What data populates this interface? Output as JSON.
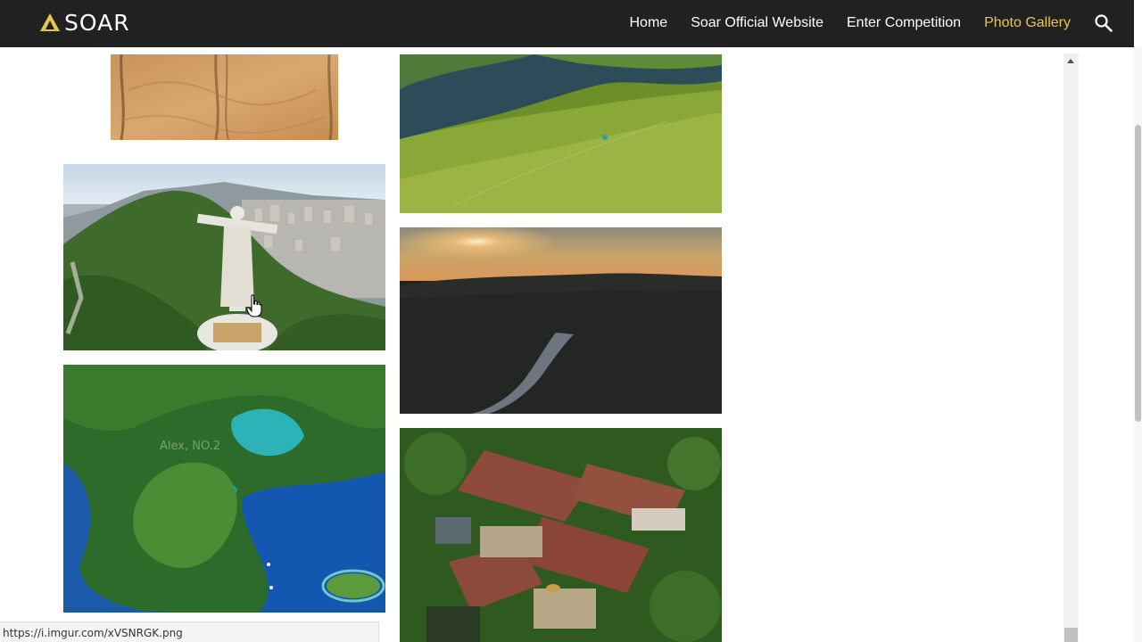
{
  "header": {
    "brand": "SOAR",
    "nav": [
      {
        "label": "Home",
        "active": false
      },
      {
        "label": "Soar Official Website",
        "active": false
      },
      {
        "label": "Enter Competition",
        "active": false
      },
      {
        "label": "Photo Gallery",
        "active": true
      }
    ],
    "search_icon": "search-icon",
    "accent_color": "#e8c64a",
    "bar_color": "#212121"
  },
  "gallery": {
    "photos": [
      {
        "name": "desert-sand-photo"
      },
      {
        "name": "christ-statue-city-photo"
      },
      {
        "name": "turquoise-lakes-forest-photo"
      },
      {
        "name": "green-hills-lake-photo"
      },
      {
        "name": "sunset-river-valley-photo"
      },
      {
        "name": "village-rooftops-photo"
      }
    ],
    "watermark_text": "Alex, NO.2"
  },
  "status_bar": {
    "url": "https://i.imgur.com/xVSNRGK.png"
  }
}
